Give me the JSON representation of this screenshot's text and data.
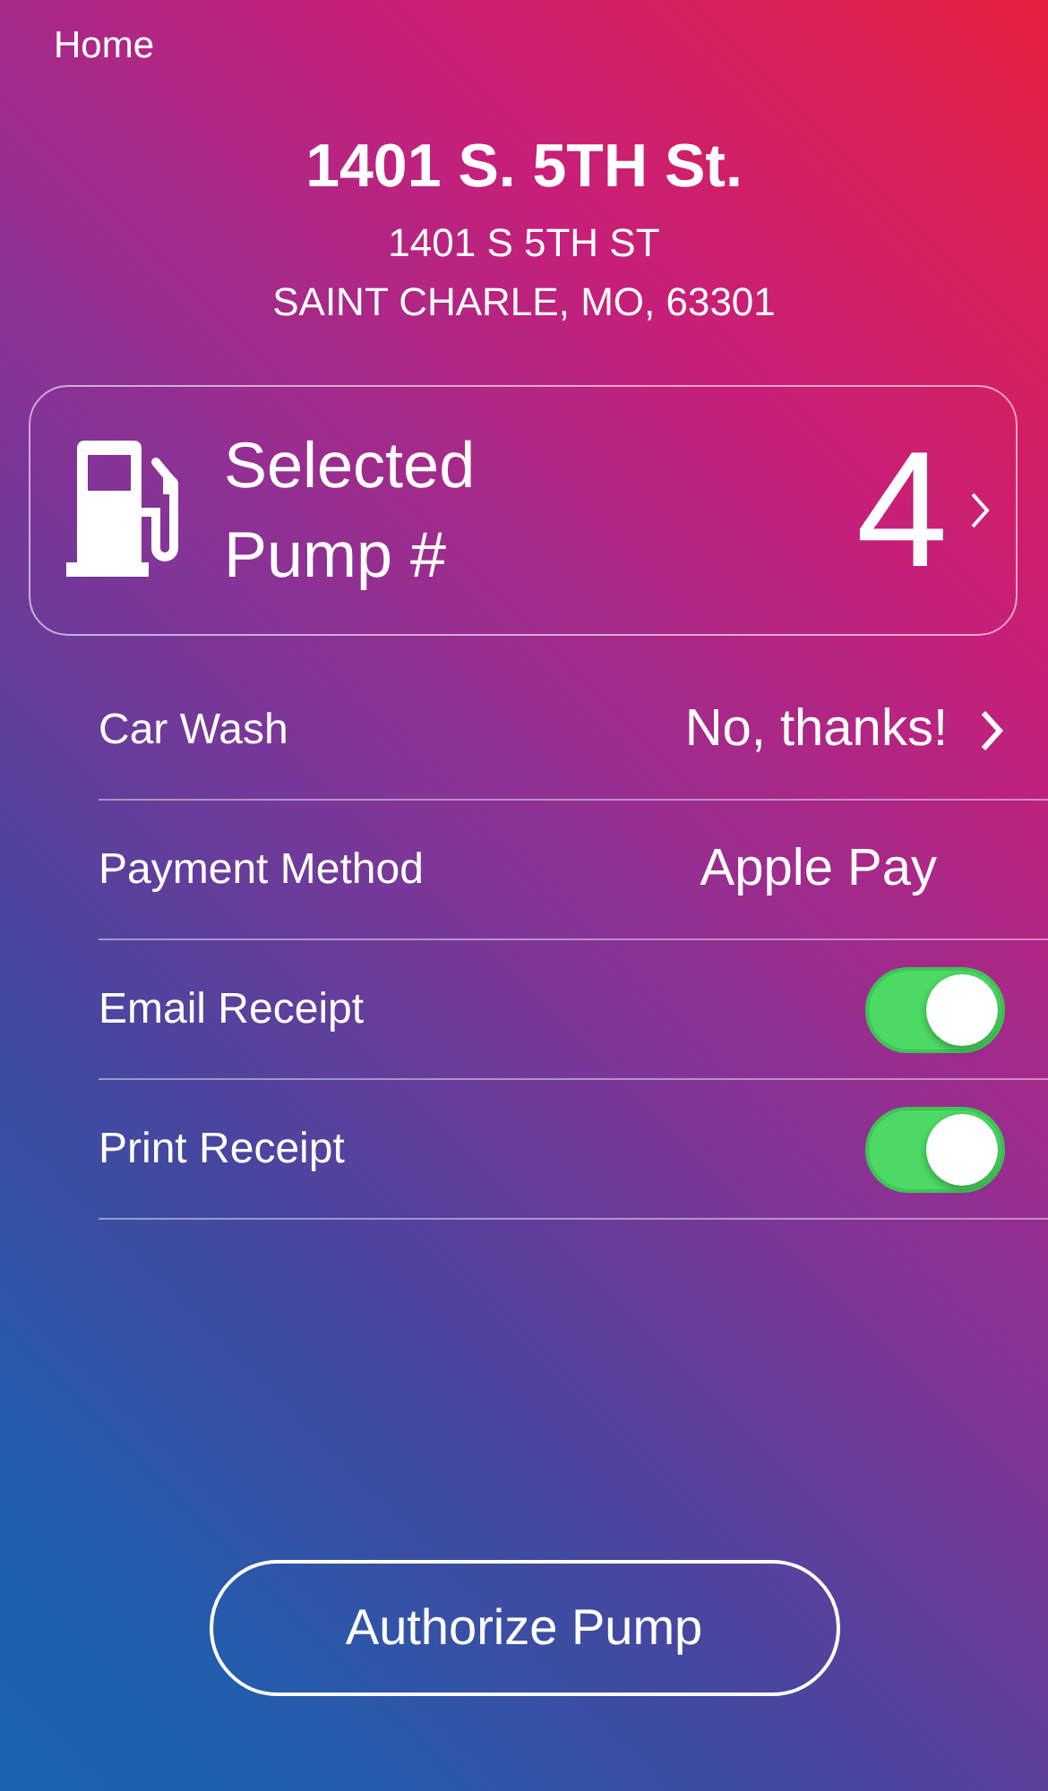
{
  "nav": {
    "back_label": "Home"
  },
  "station": {
    "name": "1401 S. 5TH St.",
    "address_lines": [
      "1401 S 5TH ST",
      "SAINT CHARLE, MO, 63301"
    ]
  },
  "pump": {
    "label_lines": [
      "Selected",
      "Pump #"
    ],
    "number": "4"
  },
  "rows": [
    {
      "kind": "link",
      "label": "Car Wash",
      "value": "No, thanks!"
    },
    {
      "kind": "value",
      "label": "Payment Method",
      "value": "Apple Pay"
    },
    {
      "kind": "toggle",
      "label": "Email Receipt",
      "on": true
    },
    {
      "kind": "toggle",
      "label": "Print Receipt",
      "on": true
    }
  ],
  "action_button": {
    "label": "Authorize Pump"
  }
}
